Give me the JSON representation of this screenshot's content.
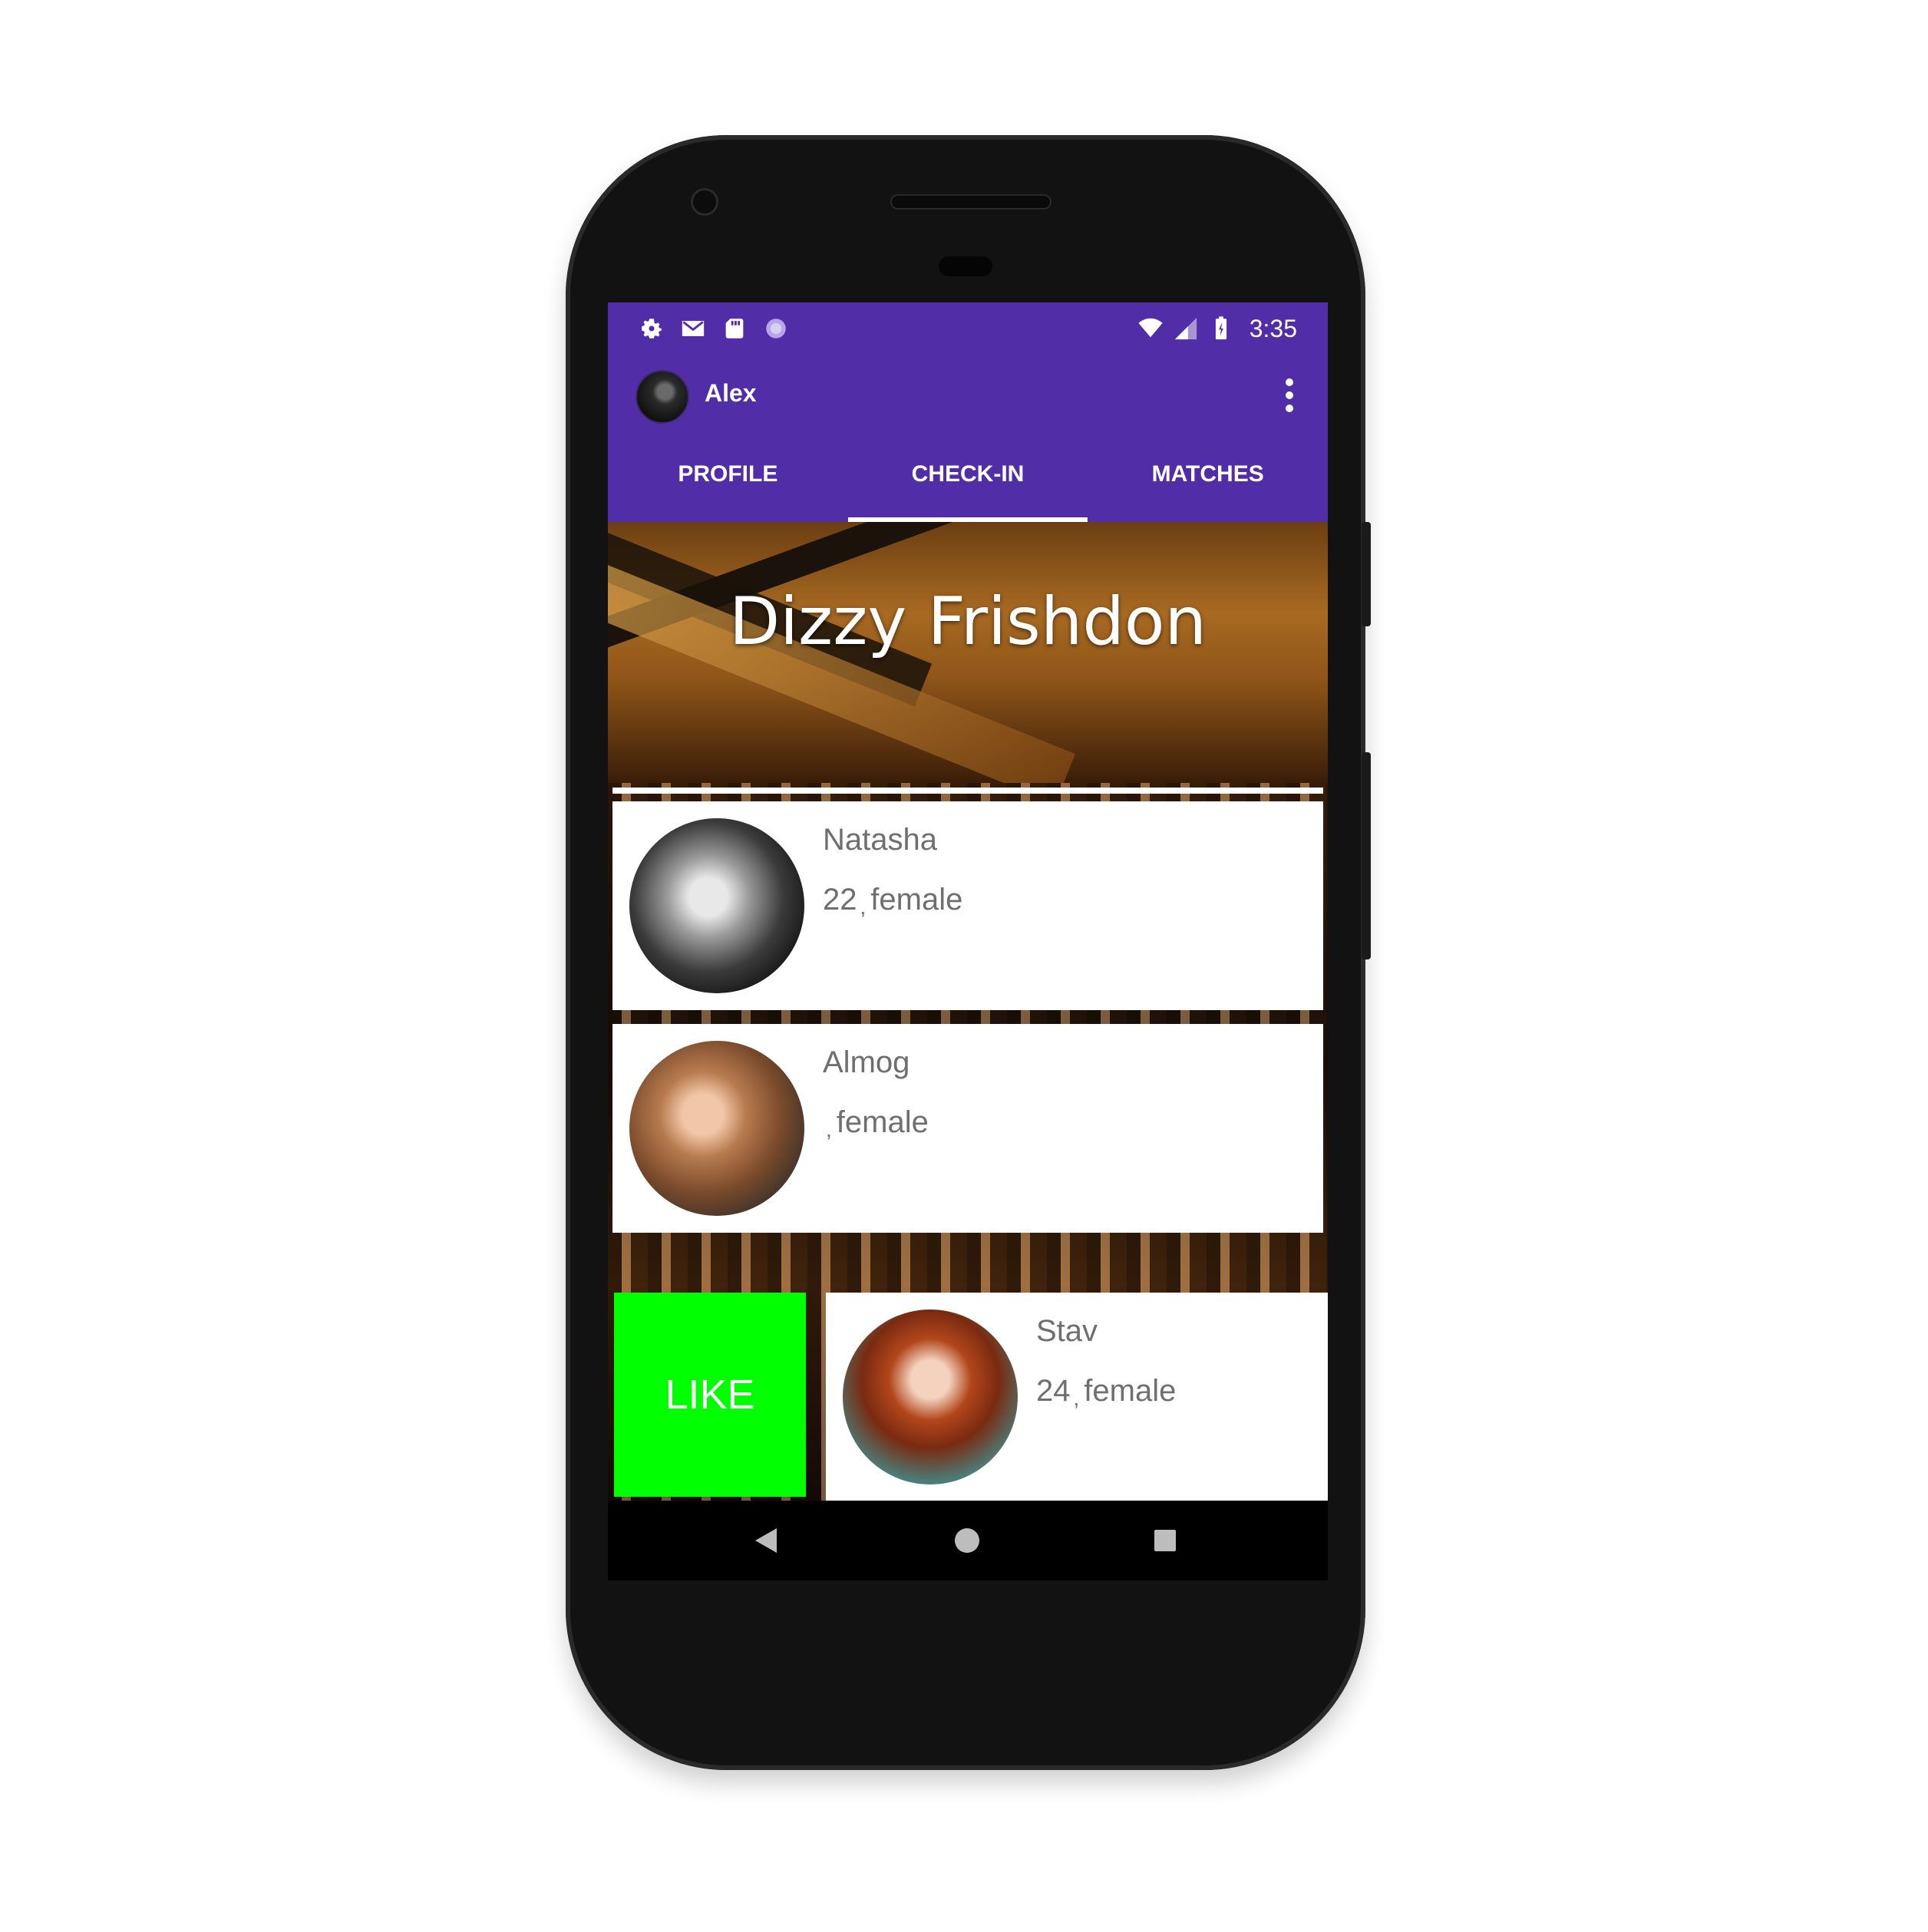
{
  "status_bar": {
    "left_icons": [
      "settings-icon",
      "gmail-icon",
      "sd-card-icon",
      "sync-icon"
    ],
    "right_icons": [
      "wifi-icon",
      "signal-icon",
      "battery-icon"
    ],
    "time": "3:35"
  },
  "app_bar": {
    "user_name": "Alex",
    "menu_icon": "overflow-menu-icon"
  },
  "tabs": [
    {
      "label": "PROFILE",
      "active": false
    },
    {
      "label": "CHECK-IN",
      "active": true
    },
    {
      "label": "MATCHES",
      "active": false
    }
  ],
  "venue": {
    "title": "Dizzy Frishdon"
  },
  "people": [
    {
      "name": "Natasha",
      "age": "22",
      "gender": "female"
    },
    {
      "name": "Almog",
      "age": "",
      "gender": "female"
    },
    {
      "name": "Stav",
      "age": "24",
      "gender": "female"
    }
  ],
  "swipe_action": {
    "label": "LIKE",
    "color": "#00FF00"
  },
  "nav_bar": [
    "back-icon",
    "home-icon",
    "recents-icon"
  ],
  "colors": {
    "primary": "#512DA8",
    "accent_white": "#FFFFFF"
  }
}
